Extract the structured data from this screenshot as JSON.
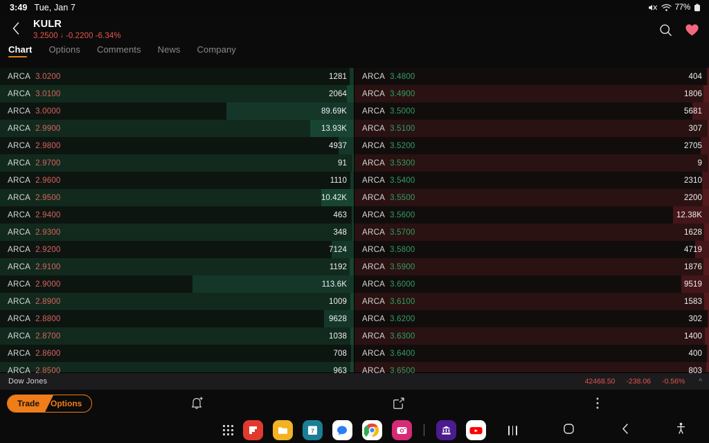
{
  "statusbar": {
    "time": "3:49",
    "date": "Tue, Jan 7",
    "battery": "77%",
    "icons": [
      "mute-icon",
      "wifi-icon",
      "battery-icon"
    ]
  },
  "header": {
    "back_icon": "chevron-left-icon",
    "symbol": "KULR",
    "price": "3.2500",
    "arrow": "↓",
    "change": "-0.2200",
    "change_pct": "-6.34%",
    "search_icon": "search-icon",
    "favorite_icon": "heart-icon",
    "change_color": "#e5564e",
    "favorite_color": "#f4677f"
  },
  "tabs": [
    {
      "label": "Chart",
      "active": true
    },
    {
      "label": "Options",
      "active": false
    },
    {
      "label": "Comments",
      "active": false
    },
    {
      "label": "News",
      "active": false
    },
    {
      "label": "Company",
      "active": false
    }
  ],
  "orderbook": {
    "accent_bid": "#2f9e63",
    "accent_ask": "#d9635f",
    "bids": [
      {
        "venue": "ARCA",
        "price": "3.0200",
        "size": "1281",
        "depth_pct": 1.2
      },
      {
        "venue": "ARCA",
        "price": "3.0100",
        "size": "2064",
        "depth_pct": 1.9
      },
      {
        "venue": "ARCA",
        "price": "3.0000",
        "size": "89.69K",
        "depth_pct": 36.0
      },
      {
        "venue": "ARCA",
        "price": "2.9900",
        "size": "13.93K",
        "depth_pct": 12.3
      },
      {
        "venue": "ARCA",
        "price": "2.9800",
        "size": "4937",
        "depth_pct": 4.4
      },
      {
        "venue": "ARCA",
        "price": "2.9700",
        "size": "91",
        "depth_pct": 0.3
      },
      {
        "venue": "ARCA",
        "price": "2.9600",
        "size": "1110",
        "depth_pct": 1.0
      },
      {
        "venue": "ARCA",
        "price": "2.9500",
        "size": "10.42K",
        "depth_pct": 9.2
      },
      {
        "venue": "ARCA",
        "price": "2.9400",
        "size": "463",
        "depth_pct": 0.5
      },
      {
        "venue": "ARCA",
        "price": "2.9300",
        "size": "348",
        "depth_pct": 0.4
      },
      {
        "venue": "ARCA",
        "price": "2.9200",
        "size": "7124",
        "depth_pct": 6.3
      },
      {
        "venue": "ARCA",
        "price": "2.9100",
        "size": "1192",
        "depth_pct": 1.1
      },
      {
        "venue": "ARCA",
        "price": "2.9000",
        "size": "113.6K",
        "depth_pct": 45.6
      },
      {
        "venue": "ARCA",
        "price": "2.8900",
        "size": "1009",
        "depth_pct": 0.9
      },
      {
        "venue": "ARCA",
        "price": "2.8800",
        "size": "9628",
        "depth_pct": 8.5
      },
      {
        "venue": "ARCA",
        "price": "2.8700",
        "size": "1038",
        "depth_pct": 0.9
      },
      {
        "venue": "ARCA",
        "price": "2.8600",
        "size": "708",
        "depth_pct": 0.7
      },
      {
        "venue": "ARCA",
        "price": "2.8500",
        "size": "963",
        "depth_pct": 0.9
      }
    ],
    "asks": [
      {
        "venue": "ARCA",
        "price": "3.4800",
        "size": "404",
        "depth_pct": 0.5
      },
      {
        "venue": "ARCA",
        "price": "3.4900",
        "size": "1806",
        "depth_pct": 1.6
      },
      {
        "venue": "ARCA",
        "price": "3.5000",
        "size": "5681",
        "depth_pct": 4.7
      },
      {
        "venue": "ARCA",
        "price": "3.5100",
        "size": "307",
        "depth_pct": 0.4
      },
      {
        "venue": "ARCA",
        "price": "3.5200",
        "size": "2705",
        "depth_pct": 2.3
      },
      {
        "venue": "ARCA",
        "price": "3.5300",
        "size": "9",
        "depth_pct": 0.2
      },
      {
        "venue": "ARCA",
        "price": "3.5400",
        "size": "2310",
        "depth_pct": 1.9
      },
      {
        "venue": "ARCA",
        "price": "3.5500",
        "size": "2200",
        "depth_pct": 1.8
      },
      {
        "venue": "ARCA",
        "price": "3.5600",
        "size": "12.38K",
        "depth_pct": 10.2
      },
      {
        "venue": "ARCA",
        "price": "3.5700",
        "size": "1628",
        "depth_pct": 1.4
      },
      {
        "venue": "ARCA",
        "price": "3.5800",
        "size": "4719",
        "depth_pct": 4.0
      },
      {
        "venue": "ARCA",
        "price": "3.5900",
        "size": "1876",
        "depth_pct": 1.6
      },
      {
        "venue": "ARCA",
        "price": "3.6000",
        "size": "9519",
        "depth_pct": 7.9
      },
      {
        "venue": "ARCA",
        "price": "3.6100",
        "size": "1583",
        "depth_pct": 1.3
      },
      {
        "venue": "ARCA",
        "price": "3.6200",
        "size": "302",
        "depth_pct": 0.4
      },
      {
        "venue": "ARCA",
        "price": "3.6300",
        "size": "1400",
        "depth_pct": 1.2
      },
      {
        "venue": "ARCA",
        "price": "3.6400",
        "size": "400",
        "depth_pct": 0.5
      },
      {
        "venue": "ARCA",
        "price": "3.6500",
        "size": "803",
        "depth_pct": 0.8
      }
    ]
  },
  "index_ticker": {
    "name": "Dow Jones",
    "value": "42468.50",
    "change": "-238.06",
    "change_pct": "-0.56%",
    "caret_icon": "chevron-up-icon",
    "color": "#e5564e"
  },
  "actionbar": {
    "trade_label": "Trade",
    "options_label": "Options",
    "accent": "#ef7d1a",
    "bell_icon": "bell-add-icon",
    "share_icon": "share-icon",
    "kebab_icon": "more-vertical-icon"
  },
  "dock": {
    "apps_grid_icon": "app-grid-icon",
    "apps": [
      {
        "name": "flipboard-app-icon",
        "bg": "#e03a2f",
        "glyph": "flag"
      },
      {
        "name": "files-app-icon",
        "bg": "#f2b224",
        "glyph": "folder"
      },
      {
        "name": "calendar-app-icon",
        "bg": "#1a7f96",
        "glyph": "7"
      },
      {
        "name": "messages-app-icon",
        "bg": "#ffffff",
        "glyph": "bubble"
      },
      {
        "name": "chrome-app-icon",
        "bg": "#ffffff",
        "glyph": "chrome"
      },
      {
        "name": "instagram-app-icon",
        "bg": "#d62976",
        "glyph": "camera"
      },
      {
        "name": "divider",
        "bg": "",
        "glyph": "divider"
      },
      {
        "name": "bank-app-icon",
        "bg": "#4b1b8f",
        "glyph": "bank"
      },
      {
        "name": "youtube-app-icon",
        "bg": "#ffffff",
        "glyph": "youtube"
      }
    ]
  },
  "navbar": {
    "recents_icon": "recents-icon",
    "home_icon": "home-icon",
    "back_icon": "back-icon",
    "accessibility_icon": "accessibility-icon"
  }
}
